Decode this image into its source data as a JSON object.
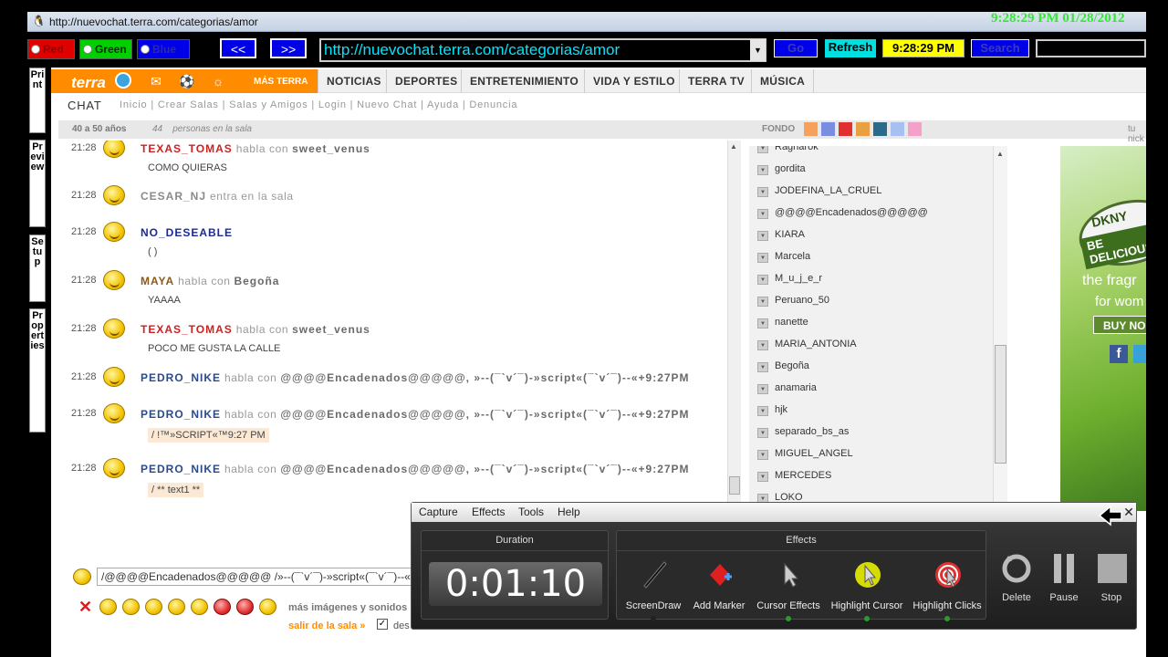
{
  "window": {
    "title": "http://nuevochat.terra.com/categorias/amor",
    "clock": "9:28:29 PM 01/28/2012"
  },
  "toolbar": {
    "red_label": "Red",
    "green_label": "Green",
    "blue_label": "Blue",
    "back_label": "<<",
    "forward_label": ">>",
    "url": "http://nuevochat.terra.com/categorias/amor",
    "go_label": "Go",
    "refresh_label": "Refresh",
    "time": "9:28:29 PM",
    "search_label": "Search",
    "search_value": ""
  },
  "side_buttons": {
    "print": "Print",
    "preview": "Preview",
    "setup": "Setup",
    "properties": "Properties"
  },
  "terra": {
    "logo": "terra",
    "mas_terra": "MÁS TERRA",
    "nav": [
      "NOTICIAS",
      "DEPORTES",
      "ENTRETENIMIENTO",
      "VIDA Y ESTILO",
      "TERRA TV",
      "MÚSICA"
    ],
    "chat_label": "CHAT",
    "chat_links": "Inicio | Crear Salas | Salas y Amigos | Login | Nuevo Chat | Ayuda | Denuncia",
    "room_age": "40 a 50 años",
    "room_count": "44",
    "room_count_label": "personas en la sala",
    "fondo_label": "FONDO",
    "tu_nick": "tu nick",
    "fondo_colors": [
      "#f7a05a",
      "#7a8ee0",
      "#e03030",
      "#e8a040",
      "#2a6a8a",
      "#a8c0f0",
      "#f4a0c8"
    ]
  },
  "messages": [
    {
      "time": "21:28",
      "user": "TEXAS_TOMAS",
      "action": "habla con",
      "target": "sweet_venus",
      "text": "COMO QUIERAS",
      "color": "red"
    },
    {
      "time": "21:28",
      "user": "CESAR_NJ",
      "action": "entra en la sala",
      "target": "",
      "text": "",
      "color": "gray"
    },
    {
      "time": "21:28",
      "user": "NO_DESEABLE",
      "action": "",
      "target": "",
      "text": "( )",
      "color": "blue"
    },
    {
      "time": "21:28",
      "user": "MAYA",
      "action": "habla con",
      "target": "Begoña",
      "text": "YAAAA",
      "color": "brown"
    },
    {
      "time": "21:28",
      "user": "TEXAS_TOMAS",
      "action": "habla con",
      "target": "sweet_venus",
      "text": "POCO ME GUSTA LA CALLE",
      "color": "red"
    },
    {
      "time": "21:28",
      "user": "PEDRO_NIKE",
      "action": "habla con",
      "target": "@@@@Encadenados@@@@@, »--(¯`v´¯)-»script«(¯`v´¯)--«+9:27PM",
      "text": "",
      "color": "teal"
    },
    {
      "time": "21:28",
      "user": "PEDRO_NIKE",
      "action": "habla con",
      "target": "@@@@Encadenados@@@@@, »--(¯`v´¯)-»script«(¯`v´¯)--«+9:27PM",
      "text": "/ !™»SCRIPT«™9:27 PM",
      "color": "teal"
    },
    {
      "time": "21:28",
      "user": "PEDRO_NIKE",
      "action": "habla con",
      "target": "@@@@Encadenados@@@@@, »--(¯`v´¯)-»script«(¯`v´¯)--«+9:27PM",
      "text": "/ ** text1 **",
      "color": "teal"
    }
  ],
  "users": [
    "Ragnarok",
    "gordita",
    "JODEFINA_LA_CRUEL",
    "@@@@Encadenados@@@@@",
    "KIARA",
    "Marcela",
    "M_u_j_e_r",
    "Peruano_50",
    "nanette",
    "MARIA_ANTONIA",
    "Begoña",
    "anamaria",
    "hjk",
    "separado_bs_as",
    "MIGUEL_ANGEL",
    "MERCEDES",
    "LOKO"
  ],
  "ad": {
    "brand": "DKNY",
    "tag": "BE DELICIOUS",
    "line1": "the fragr",
    "line2": "for wom",
    "buy": "BUY NO"
  },
  "input": {
    "value": "/@@@@Encadenados@@@@@ /»--(¯`v´¯)-»script«(¯`v´¯)--«"
  },
  "footer": {
    "more_images": "más imágenes y sonidos",
    "leave_room": "salir de la sala »",
    "des": "des"
  },
  "capture": {
    "menu": [
      "Capture",
      "Effects",
      "Tools",
      "Help"
    ],
    "duration_label": "Duration",
    "duration_value": "0:01:10",
    "effects_label": "Effects",
    "effects": [
      "ScreenDraw",
      "Add Marker",
      "Cursor Effects",
      "Highlight Cursor",
      "Highlight Clicks"
    ],
    "controls": [
      "Delete",
      "Pause",
      "Stop"
    ]
  }
}
